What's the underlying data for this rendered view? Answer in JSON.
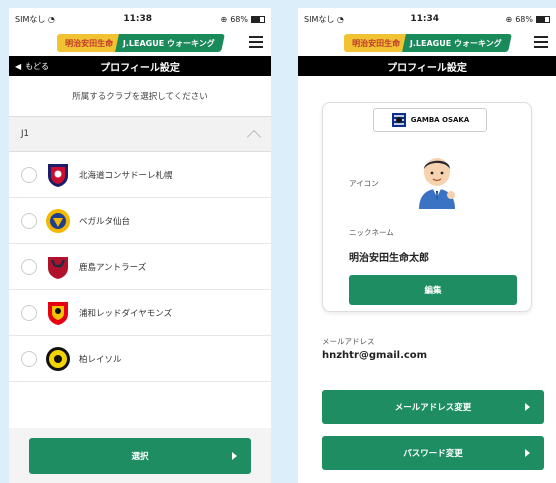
{
  "left": {
    "status": {
      "carrier": "SIMなし",
      "time": "11:38",
      "battery": "68%"
    },
    "logo": {
      "sponsor": "明治安田生命",
      "brand": "J.LEAGUE ウォーキング"
    },
    "back_label": "もどる",
    "title": "プロフィール設定",
    "prompt": "所属するクラブを選択してください",
    "group": "J1",
    "clubs": [
      {
        "name": "北海道コンサドーレ札幌",
        "color": "#c8102e",
        "accent": "#1c1c6b"
      },
      {
        "name": "ベガルタ仙台",
        "color": "#f5b800",
        "accent": "#1d3f8f"
      },
      {
        "name": "鹿島アントラーズ",
        "color": "#b0122c",
        "accent": "#1f2a44"
      },
      {
        "name": "浦和レッドダイヤモンズ",
        "color": "#e60012",
        "accent": "#111111"
      },
      {
        "name": "柏レイソル",
        "color": "#f2d400",
        "accent": "#111111"
      }
    ],
    "select_label": "選択"
  },
  "right": {
    "status": {
      "carrier": "SIMなし",
      "time": "11:34",
      "battery": "68%"
    },
    "logo": {
      "sponsor": "明治安田生命",
      "brand": "J.LEAGUE ウォーキング"
    },
    "title": "プロフィール設定",
    "club": "GAMBA OSAKA",
    "icon_label": "アイコン",
    "nickname_label": "ニックネーム",
    "nickname": "明治安田生命太郎",
    "edit_label": "編集",
    "mail_label": "メールアドレス",
    "mail": "hnzhtr@gmail.com",
    "change_mail_label": "メールアドレス変更",
    "change_password_label": "パスワード変更"
  },
  "colors": {
    "brand_green": "#1e8d62",
    "title_bar": "#000000",
    "gamba_blue": "#0b2f8a"
  }
}
